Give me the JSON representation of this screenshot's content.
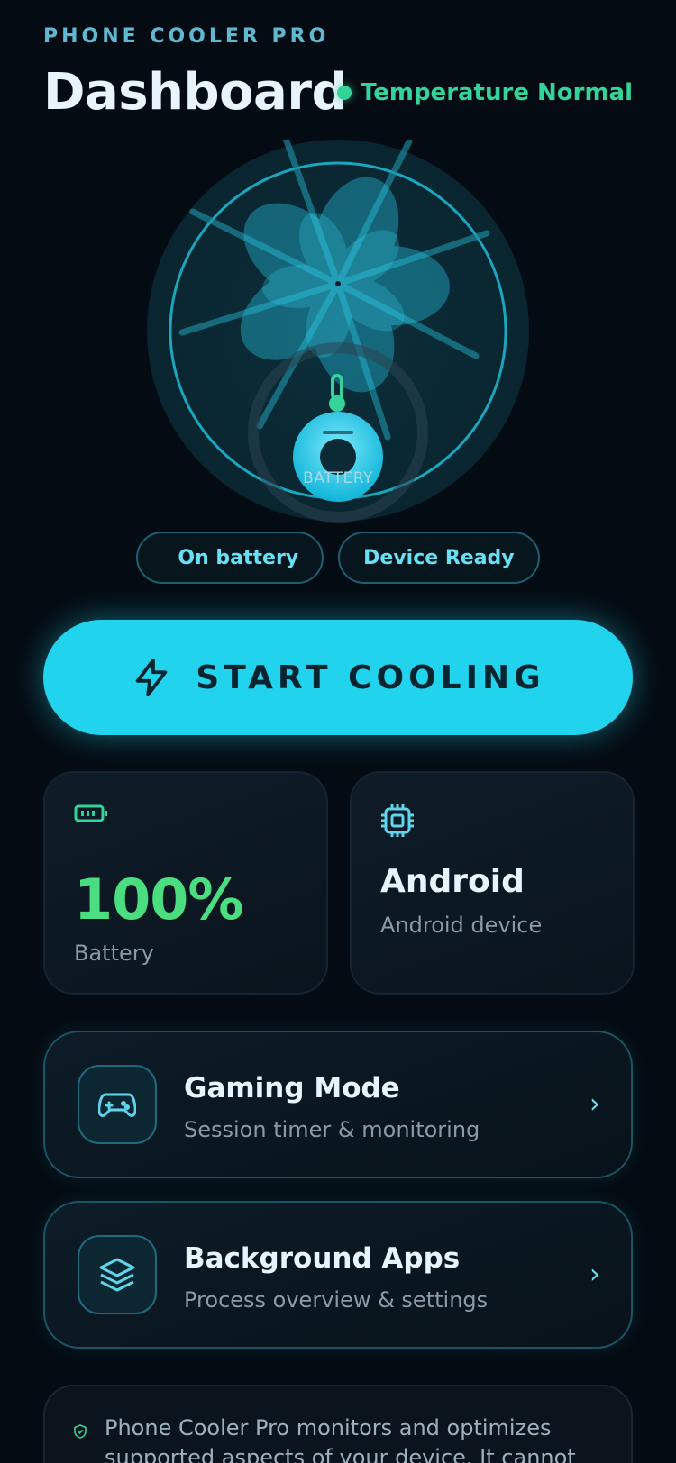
{
  "header": {
    "app_name": "PHONE COOLER PRO",
    "title": "Dashboard",
    "status_text": "Temperature Normal",
    "status_color": "#34d399"
  },
  "fan": {
    "center_label": "BATTERY",
    "icons": [
      "fan-icon",
      "thermometer-icon"
    ]
  },
  "pills": [
    "On battery",
    "Device Ready"
  ],
  "start_button": {
    "label": "START COOLING",
    "icon": "lightning-icon",
    "color": "#22d3ee"
  },
  "stats": {
    "battery": {
      "value": "100%",
      "caption": "Battery",
      "icon": "battery-icon",
      "color": "#4ade80"
    },
    "device": {
      "name": "Android",
      "sub": "Android device",
      "icon": "cpu-icon"
    }
  },
  "features": [
    {
      "title": "Gaming Mode",
      "subtitle": "Session timer & monitoring",
      "icon": "gamepad-icon",
      "chevron": "›"
    },
    {
      "title": "Background Apps",
      "subtitle": "Process overview & settings",
      "icon": "layers-icon",
      "chevron": "›"
    }
  ],
  "notice": {
    "icon": "shield-icon",
    "text": "Phone Cooler Pro monitors and optimizes supported aspects of your device. It cannot"
  }
}
